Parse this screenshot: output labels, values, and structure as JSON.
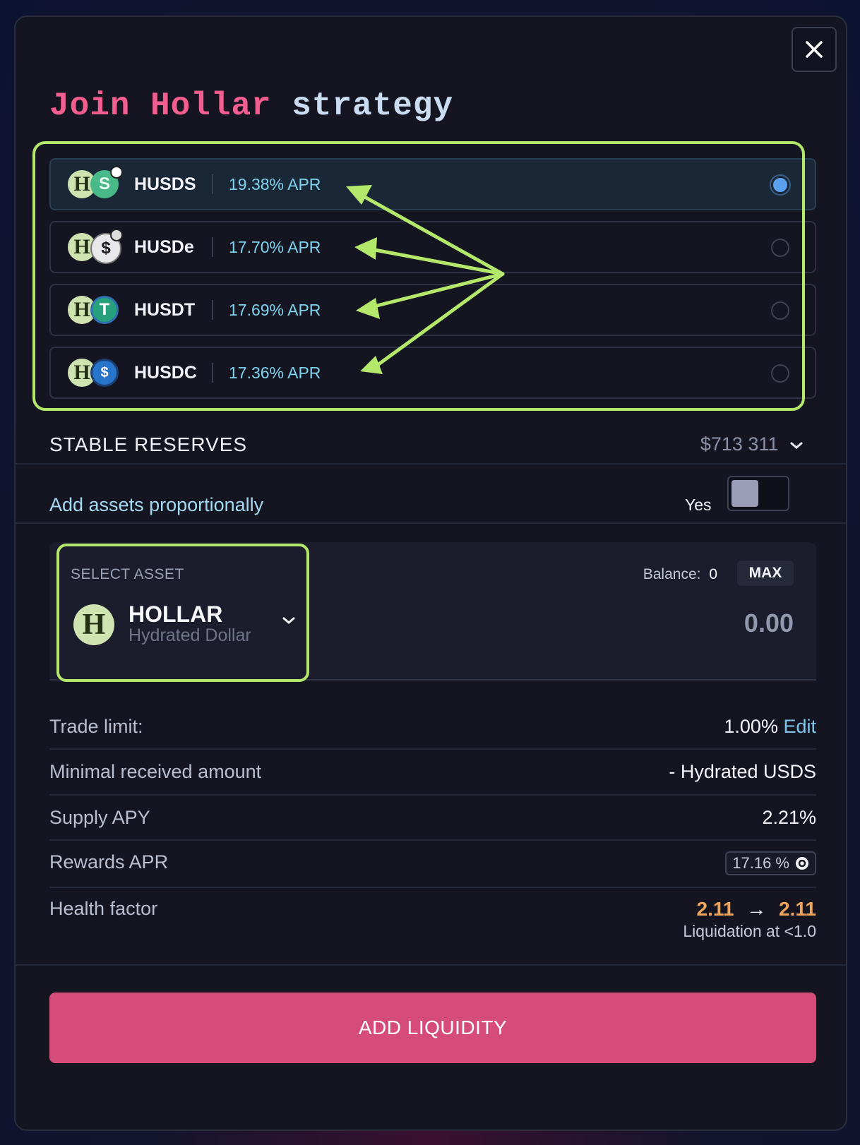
{
  "modal": {
    "title_part1": "Join Hollar",
    "title_part2": "strategy"
  },
  "strategies": [
    {
      "name": "HUSDS",
      "apr": "19.38% APR",
      "selected": true
    },
    {
      "name": "HUSDe",
      "apr": "17.70% APR",
      "selected": false
    },
    {
      "name": "HUSDT",
      "apr": "17.69% APR",
      "selected": false
    },
    {
      "name": "HUSDC",
      "apr": "17.36% APR",
      "selected": false
    }
  ],
  "reserves": {
    "label": "STABLE  RESERVES",
    "value": "$713 311"
  },
  "proportional": {
    "label": "Add assets proportionally",
    "toggle_text": "Yes"
  },
  "asset_select": {
    "label": "SELECT ASSET",
    "balance_label": "Balance:",
    "balance_value": "0",
    "max_label": "MAX",
    "asset_symbol": "HOLLAR",
    "asset_name": "Hydrated Dollar",
    "amount_placeholder": "0.00"
  },
  "details": {
    "trade_limit_label": "Trade limit:",
    "trade_limit_value": "1.00%",
    "trade_limit_edit": "Edit",
    "min_received_label": "Minimal received amount",
    "min_received_value": "- Hydrated USDS",
    "supply_apy_label": "Supply APY",
    "supply_apy_value": "2.21%",
    "rewards_apr_label": "Rewards APR",
    "rewards_apr_value": "17.16 %",
    "health_factor_label": "Health factor",
    "health_from": "2.11",
    "health_to": "2.11",
    "liquidation_text": "Liquidation at <1.0"
  },
  "cta": {
    "label": "ADD LIQUIDITY"
  },
  "colors": {
    "accent_pink": "#d54c7a",
    "highlight_green": "#b3e86a",
    "apr_blue": "#7fd3ef"
  }
}
